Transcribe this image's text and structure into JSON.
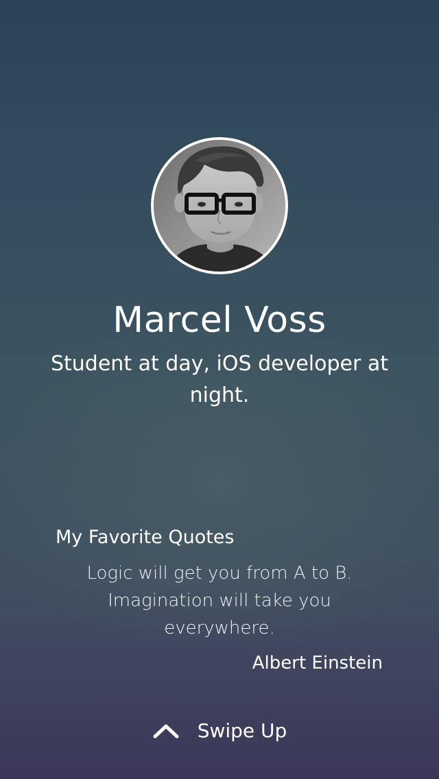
{
  "profile": {
    "name": "Marcel Voss",
    "tagline": "Student at day, iOS developer at night.",
    "avatar_alt": "Profile photo"
  },
  "quotes": {
    "title": "My Favorite Quotes",
    "items": [
      {
        "text": "Logic will get you from A to B. Imagination will take you everywhere.",
        "author": "Albert Einstein"
      }
    ]
  },
  "footer": {
    "swipe_label": "Swipe Up",
    "icon": "chevron-up-icon"
  },
  "colors": {
    "background_top": "#2a4456",
    "background_bottom": "#3a3658",
    "text": "#ffffff",
    "avatar_border": "#ffffff"
  }
}
